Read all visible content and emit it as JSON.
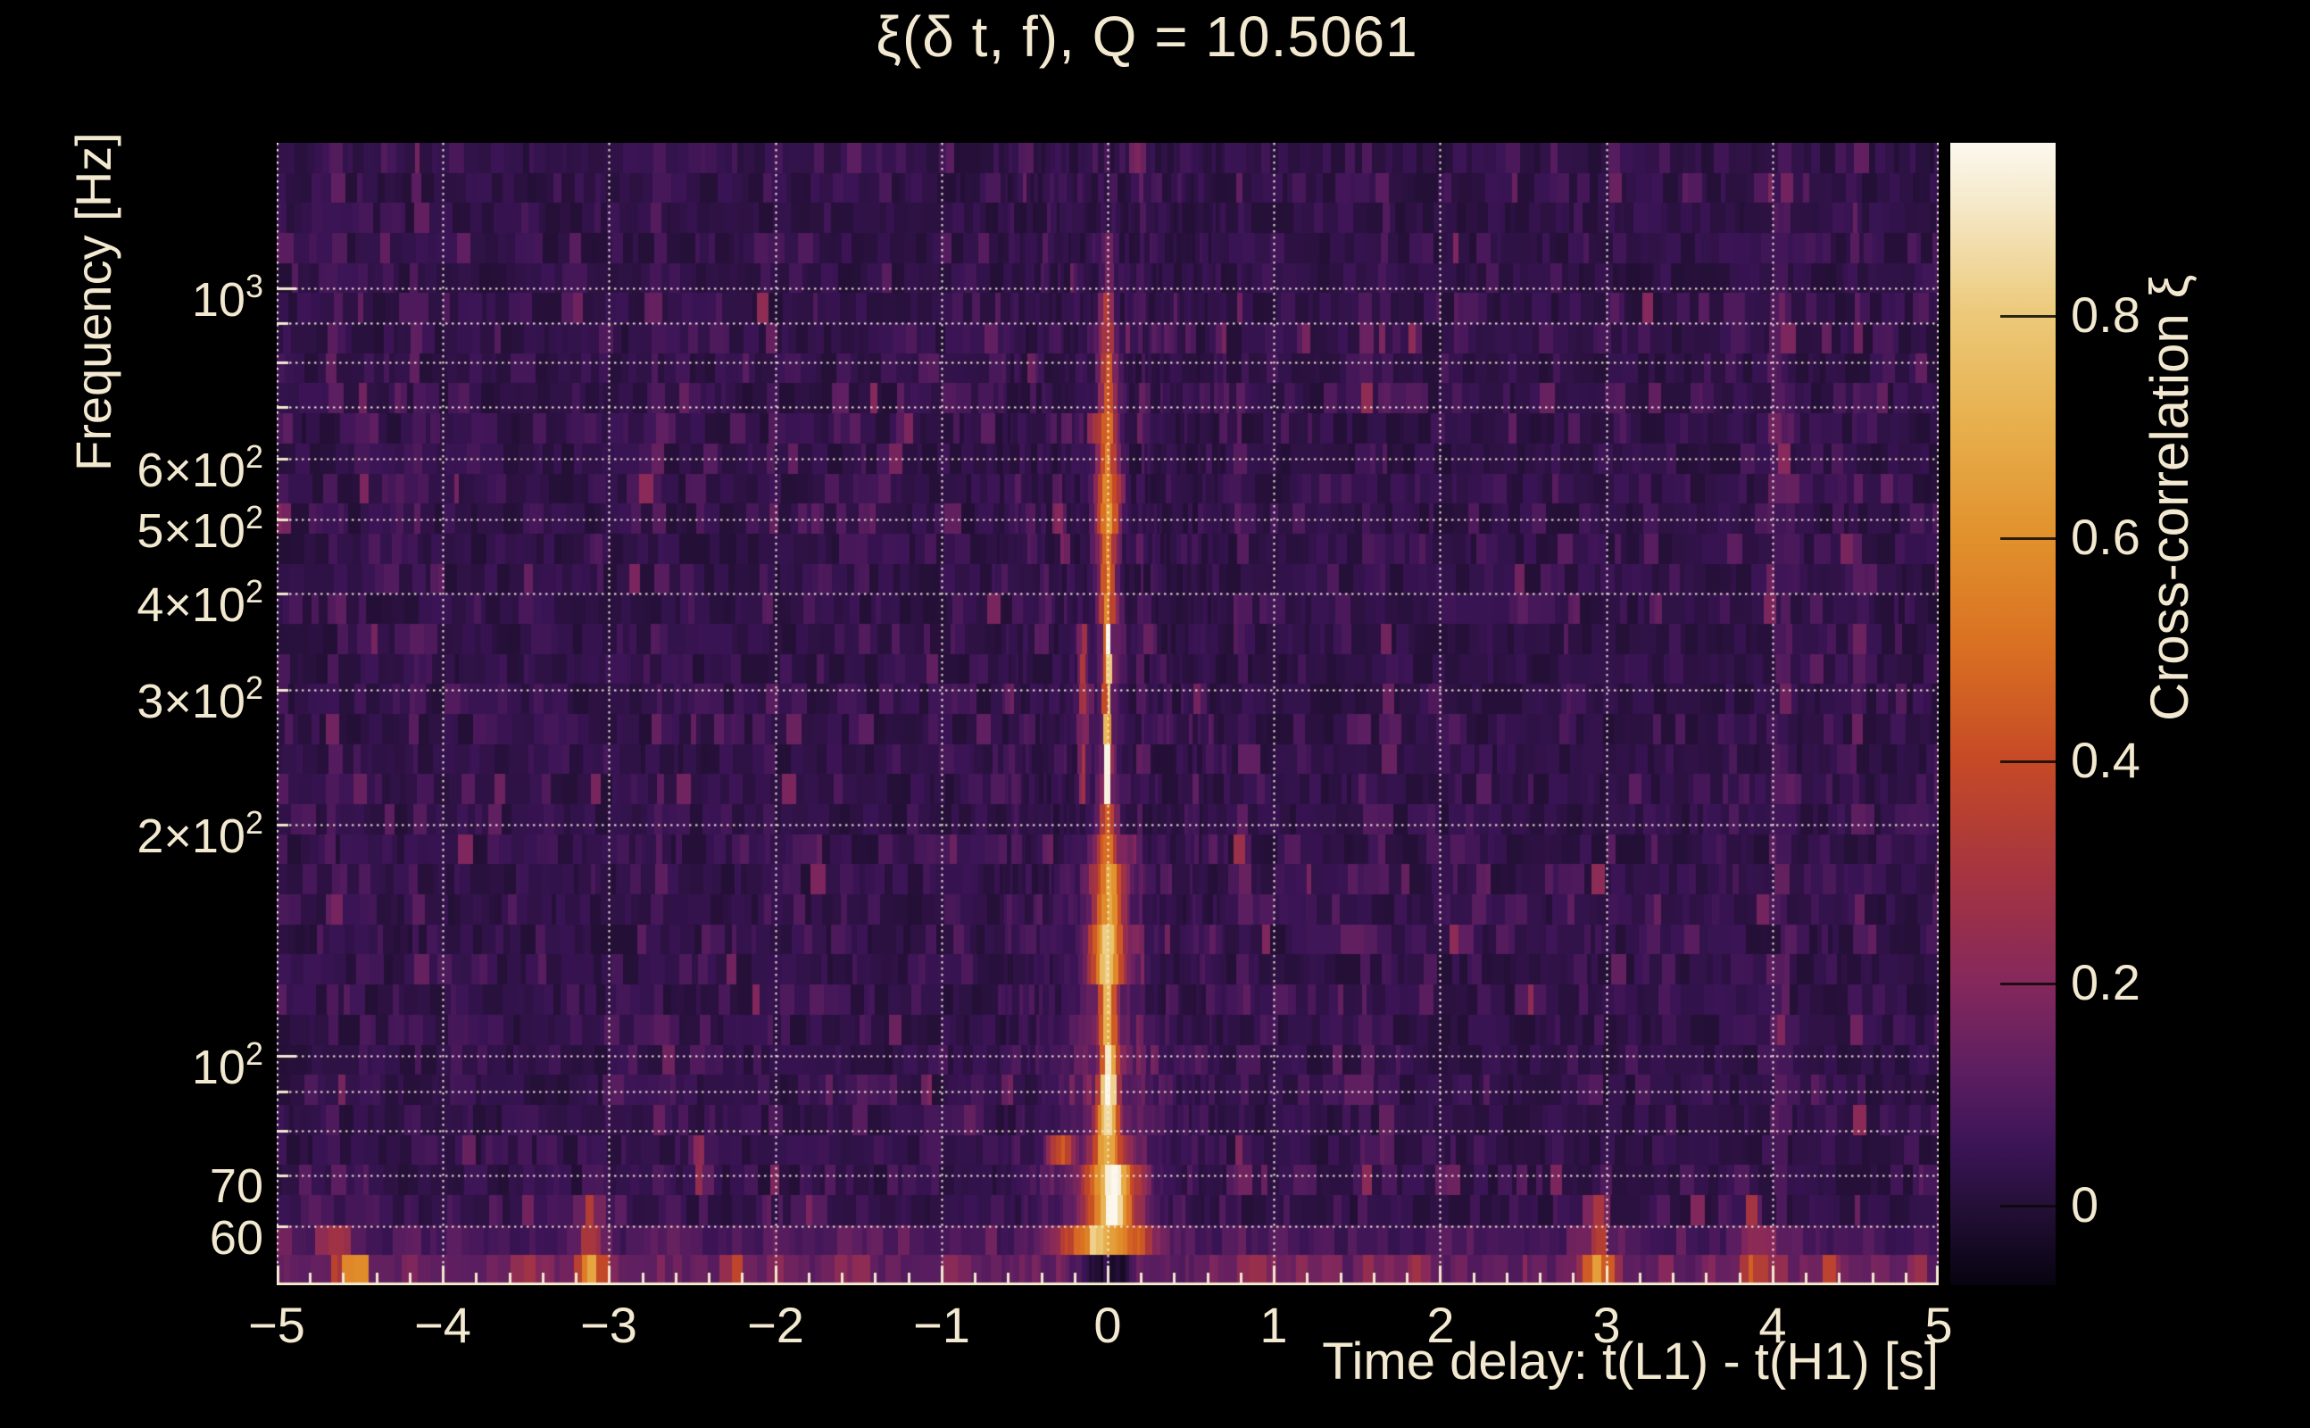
{
  "title": "ξ(δ t, f), Q = 10.5061",
  "axes": {
    "x": {
      "label": "Time delay: t(L1) - t(H1) [s]",
      "ticks": [
        {
          "label": "−5"
        },
        {
          "label": "−4"
        },
        {
          "label": "−3"
        },
        {
          "label": "−2"
        },
        {
          "label": "−1"
        },
        {
          "label": "0"
        },
        {
          "label": "1"
        },
        {
          "label": "2"
        },
        {
          "label": "3"
        },
        {
          "label": "4"
        },
        {
          "label": "5"
        }
      ]
    },
    "y": {
      "label": "Frequency [Hz]",
      "ticks": [
        {
          "main": "10",
          "sup": "3"
        },
        {
          "main": "6×10",
          "sup": "2"
        },
        {
          "main": "5×10",
          "sup": "2"
        },
        {
          "main": "4×10",
          "sup": "2"
        },
        {
          "main": "3×10",
          "sup": "2"
        },
        {
          "main": "2×10",
          "sup": "2"
        },
        {
          "main": "10",
          "sup": "2"
        },
        {
          "main": "70",
          "sup": ""
        },
        {
          "main": "60",
          "sup": ""
        }
      ]
    }
  },
  "colorbar": {
    "label": "Cross-correlation ξ",
    "ticks": [
      {
        "value": 0.8,
        "label": "0.8"
      },
      {
        "value": 0.6,
        "label": "0.6"
      },
      {
        "value": 0.4,
        "label": "0.4"
      },
      {
        "value": 0.2,
        "label": "0.2"
      },
      {
        "value": 0.0,
        "label": "0"
      }
    ]
  },
  "chart_data": {
    "type": "heatmap",
    "title": "ξ(δ t, f), Q = 10.5061",
    "xlabel": "Time delay: t(L1) - t(H1) [s]",
    "ylabel": "Frequency [Hz]",
    "x_range": [
      -5,
      5
    ],
    "y_range_hz": [
      50.3,
      1547
    ],
    "y_scale": "log",
    "grid": true,
    "x_gridlines": [
      -5,
      -4,
      -3,
      -2,
      -1,
      0,
      1,
      2,
      3,
      4,
      5
    ],
    "y_gridlines_hz": [
      60,
      70,
      80,
      90,
      100,
      200,
      300,
      400,
      500,
      600,
      700,
      800,
      900,
      1000
    ],
    "value_range": [
      -0.072,
      0.955
    ],
    "colormap_stops": [
      [
        -0.072,
        "#070310"
      ],
      [
        0.0,
        "#251038"
      ],
      [
        0.05,
        "#3a1455"
      ],
      [
        0.12,
        "#5c1e60"
      ],
      [
        0.2,
        "#85285c"
      ],
      [
        0.3,
        "#a6353f"
      ],
      [
        0.4,
        "#c64a26"
      ],
      [
        0.5,
        "#d96f22"
      ],
      [
        0.6,
        "#e1912c"
      ],
      [
        0.7,
        "#e7af4c"
      ],
      [
        0.8,
        "#ecc979"
      ],
      [
        0.9,
        "#f5e9c9"
      ],
      [
        0.955,
        "#fcf8ef"
      ]
    ],
    "ridge": [
      {
        "f": [
          57,
          63
        ],
        "t": -0.02,
        "sigma": 0.16,
        "amp": 0.52
      },
      {
        "f": [
          57,
          110
        ],
        "t": 0.0,
        "sigma": 0.22,
        "amp": 0.1
      },
      {
        "f": [
          63,
          70
        ],
        "t": 0.02,
        "sigma": 0.1,
        "amp": 0.62
      },
      {
        "f": [
          63,
          70
        ],
        "t": 0.04,
        "sigma": 0.03,
        "amp": 0.35
      },
      {
        "f": [
          70,
          78
        ],
        "t": 0.0,
        "sigma": 0.06,
        "amp": 0.6
      },
      {
        "f": [
          70,
          82
        ],
        "t": -0.27,
        "sigma": 0.045,
        "amp": 0.38
      },
      {
        "f": [
          78,
          86
        ],
        "t": 0.0,
        "sigma": 0.045,
        "amp": 0.75
      },
      {
        "f": [
          86,
          96
        ],
        "t": 0.0,
        "sigma": 0.032,
        "amp": 0.93
      },
      {
        "f": [
          96,
          108
        ],
        "t": 0.01,
        "sigma": 0.03,
        "amp": 0.8
      },
      {
        "f": [
          108,
          128
        ],
        "t": 0.0,
        "sigma": 0.035,
        "amp": 0.6
      },
      {
        "f": [
          110,
          200
        ],
        "t": 0.0,
        "sigma": 0.15,
        "amp": 0.06
      },
      {
        "f": [
          128,
          150
        ],
        "t": 0.0,
        "sigma": 0.08,
        "amp": 0.5
      },
      {
        "f": [
          128,
          150
        ],
        "t": 0.0,
        "sigma": 0.03,
        "amp": 0.25
      },
      {
        "f": [
          150,
          175
        ],
        "t": 0.01,
        "sigma": 0.06,
        "amp": 0.55
      },
      {
        "f": [
          175,
          205
        ],
        "t": 0.0,
        "sigma": 0.04,
        "amp": 0.45
      },
      {
        "f": [
          205,
          360
        ],
        "t": 0.0,
        "sigma": 0.013,
        "amp": 0.8
      },
      {
        "f": [
          205,
          360
        ],
        "t": -0.15,
        "sigma": 0.018,
        "amp": 0.28
      },
      {
        "f": [
          205,
          360
        ],
        "t": 0.0,
        "sigma": 0.05,
        "amp": 0.12
      },
      {
        "f": [
          360,
          460
        ],
        "t": 0.0,
        "sigma": 0.035,
        "amp": 0.5
      },
      {
        "f": [
          460,
          560
        ],
        "t": 0.0,
        "sigma": 0.05,
        "amp": 0.55
      },
      {
        "f": [
          560,
          660
        ],
        "t": 0.0,
        "sigma": 0.04,
        "amp": 0.5
      },
      {
        "f": [
          660,
          800
        ],
        "t": 0.0,
        "sigma": 0.035,
        "amp": 0.42
      },
      {
        "f": [
          800,
          950
        ],
        "t": 0.0,
        "sigma": 0.03,
        "amp": 0.3
      },
      {
        "f": [
          950,
          1200
        ],
        "t": 0.0,
        "sigma": 0.03,
        "amp": 0.14
      }
    ],
    "hotspots": [
      {
        "t": -4.55,
        "f": [
          50,
          57
        ],
        "sigma": 0.06,
        "amp": 0.42
      },
      {
        "t": -4.62,
        "f": [
          57,
          63
        ],
        "sigma": 0.05,
        "amp": 0.18
      },
      {
        "t": -3.1,
        "f": [
          50,
          57
        ],
        "sigma": 0.06,
        "amp": 0.5
      },
      {
        "t": -3.1,
        "f": [
          57,
          68
        ],
        "sigma": 0.05,
        "amp": 0.25
      },
      {
        "t": -3.5,
        "f": [
          50,
          57
        ],
        "sigma": 0.05,
        "amp": 0.2
      },
      {
        "t": -2.45,
        "f": [
          68,
          80
        ],
        "sigma": 0.04,
        "amp": 0.22
      },
      {
        "t": -2.25,
        "f": [
          50,
          57
        ],
        "sigma": 0.05,
        "amp": 0.18
      },
      {
        "t": -1.5,
        "f": [
          50,
          57
        ],
        "sigma": 0.05,
        "amp": 0.12
      },
      {
        "t": -0.9,
        "f": [
          50,
          57
        ],
        "sigma": 0.04,
        "amp": 0.1
      },
      {
        "t": 0.0,
        "f": [
          50,
          57
        ],
        "sigma": 0.12,
        "amp": -0.16
      },
      {
        "t": 0.9,
        "f": [
          50,
          57
        ],
        "sigma": 0.05,
        "amp": 0.15
      },
      {
        "t": 1.85,
        "f": [
          50,
          57
        ],
        "sigma": 0.05,
        "amp": 0.16
      },
      {
        "t": 2.95,
        "f": [
          50,
          57
        ],
        "sigma": 0.06,
        "amp": 0.5
      },
      {
        "t": 2.95,
        "f": [
          57,
          68
        ],
        "sigma": 0.05,
        "amp": 0.28
      },
      {
        "t": 3.88,
        "f": [
          50,
          57
        ],
        "sigma": 0.05,
        "amp": 0.34
      },
      {
        "t": 3.88,
        "f": [
          57,
          66
        ],
        "sigma": 0.04,
        "amp": 0.18
      },
      {
        "t": 4.35,
        "f": [
          50,
          57
        ],
        "sigma": 0.05,
        "amp": 0.16
      }
    ],
    "noise": {
      "seed": 42,
      "rows": 38,
      "columns": 240,
      "background": 0.012,
      "striation": 0.55
    }
  }
}
